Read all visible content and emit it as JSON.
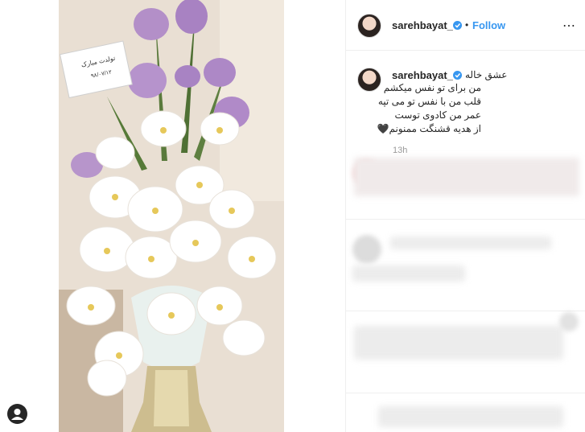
{
  "post": {
    "author": "sarehbayat_",
    "follow_label": "Follow",
    "dot": "•",
    "more_icon": "⋯",
    "caption_author": "sarehbayat_",
    "caption_lines": [
      "عشق خاله",
      "من برای تو نفس میکشم",
      "قلب من با نفس تو می تپه",
      "عمر من کادوی توست",
      "از هدیه قشنگت ممنونم🖤"
    ],
    "time": "13h",
    "card_text": [
      "تولدت مبارک",
      "۹۸/۰۷/۱۲"
    ]
  },
  "icons": {
    "verified": "verified-badge-icon",
    "profile": "profile-icon",
    "more": "more-options-icon"
  },
  "colors": {
    "link": "#3897f0",
    "verified": "#3897f0",
    "text": "#262626",
    "muted": "#999999"
  }
}
